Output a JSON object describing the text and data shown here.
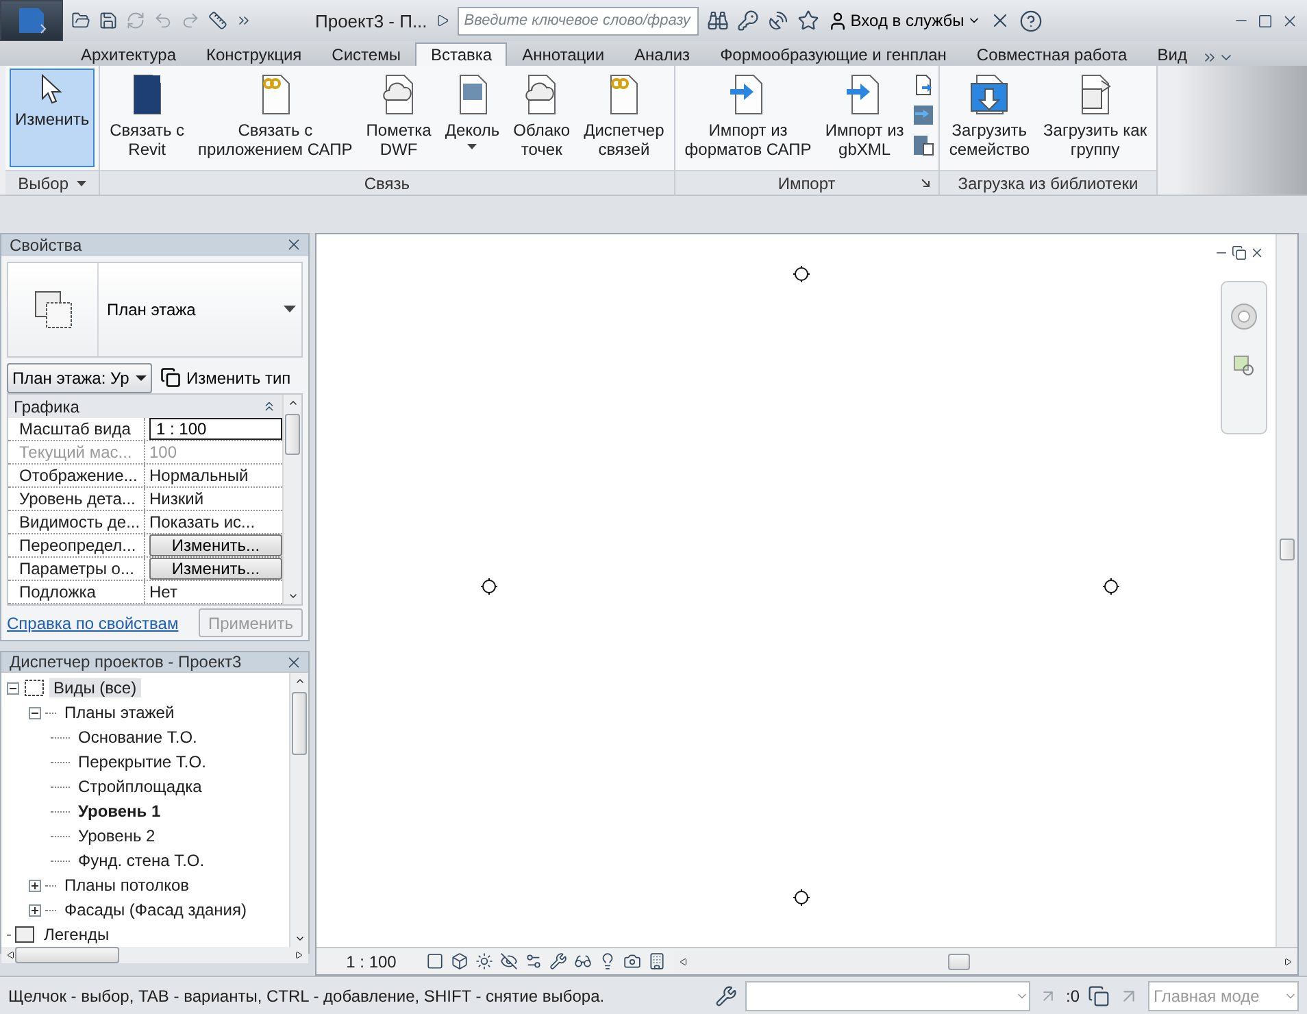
{
  "title_bar": {
    "title": "Проект3 - П...",
    "search": {
      "placeholder": "Введите ключевое слово/фразу"
    },
    "sign_in": "Вход в службы"
  },
  "ribbon_tabs": [
    {
      "label": "Архитектура",
      "selected": false
    },
    {
      "label": "Конструкция",
      "selected": false
    },
    {
      "label": "Системы",
      "selected": false
    },
    {
      "label": "Вставка",
      "selected": true
    },
    {
      "label": "Аннотации",
      "selected": false
    },
    {
      "label": "Анализ",
      "selected": false
    },
    {
      "label": "Формообразующие и генплан",
      "selected": false
    },
    {
      "label": "Совместная работа",
      "selected": false
    },
    {
      "label": "Вид",
      "selected": false
    }
  ],
  "ribbon_panels": [
    {
      "label": "Выбор",
      "menu": true,
      "launcher": false,
      "buttons": [
        {
          "label": "Изменить",
          "active": true,
          "dropdown": false
        }
      ]
    },
    {
      "label": "Связь",
      "menu": false,
      "launcher": false,
      "buttons": [
        {
          "label": "Связать с\nRevit",
          "active": false,
          "dropdown": false
        },
        {
          "label": "Связать с\nприложением САПР",
          "active": false,
          "dropdown": false
        },
        {
          "label": "Пометка\nDWF",
          "active": false,
          "dropdown": false
        },
        {
          "label": "Деколь",
          "active": false,
          "dropdown": true
        },
        {
          "label": "Облако\nточек",
          "active": false,
          "dropdown": false
        },
        {
          "label": "Диспетчер\nсвязей",
          "active": false,
          "dropdown": false
        }
      ]
    },
    {
      "label": "Импорт",
      "menu": false,
      "launcher": true,
      "buttons": [
        {
          "label": "Импорт из\nформатов САПР",
          "active": false,
          "dropdown": false
        },
        {
          "label": "Импорт из\ngbXML",
          "active": false,
          "dropdown": false
        }
      ]
    },
    {
      "label": "Загрузка из библиотеки",
      "menu": false,
      "launcher": false,
      "buttons": [
        {
          "label": "Загрузить\nсемейство",
          "active": false,
          "dropdown": false
        },
        {
          "label": "Загрузить как\nгруппу",
          "active": false,
          "dropdown": false
        }
      ]
    }
  ],
  "properties": {
    "title": "Свойства",
    "type_name": "План этажа",
    "instance_filter": "План этажа: Ур",
    "edit_type": "Изменить тип",
    "group": "Графика",
    "rows": [
      {
        "name": "Масштаб вида",
        "value": "1 : 100",
        "kind": "input",
        "disabled": false
      },
      {
        "name": "Текущий мас...",
        "value": "100",
        "kind": "text",
        "disabled": true
      },
      {
        "name": "Отображение...",
        "value": "Нормальный",
        "kind": "text",
        "disabled": false
      },
      {
        "name": "Уровень дета...",
        "value": "Низкий",
        "kind": "text",
        "disabled": false
      },
      {
        "name": "Видимость де...",
        "value": "Показать ис...",
        "kind": "text",
        "disabled": false
      },
      {
        "name": "Переопредел...",
        "value": "Изменить...",
        "kind": "button",
        "disabled": false
      },
      {
        "name": "Параметры о...",
        "value": "Изменить...",
        "kind": "button",
        "disabled": false
      },
      {
        "name": "Подложка",
        "value": "Нет",
        "kind": "text",
        "disabled": false
      }
    ],
    "help_link": "Справка по свойствам",
    "apply": {
      "label": "Применить",
      "disabled": true
    }
  },
  "project_browser": {
    "title": "Диспетчер проектов - Проект3",
    "tree": [
      {
        "label": "Виды (все)",
        "expanded": true,
        "selected": true,
        "active": false,
        "children": [
          {
            "label": "Планы этажей",
            "expanded": true,
            "selected": false,
            "active": false,
            "children": [
              {
                "label": "Основание Т.О.",
                "selected": false,
                "active": false
              },
              {
                "label": "Перекрытие Т.О.",
                "selected": false,
                "active": false
              },
              {
                "label": "Стройплощадка",
                "selected": false,
                "active": false
              },
              {
                "label": "Уровень 1",
                "selected": false,
                "active": true
              },
              {
                "label": "Уровень 2",
                "selected": false,
                "active": false
              },
              {
                "label": "Фунд. стена Т.О.",
                "selected": false,
                "active": false
              }
            ]
          },
          {
            "label": "Планы потолков",
            "expanded": false,
            "selected": false,
            "active": false
          },
          {
            "label": "Фасады (Фасад здания)",
            "expanded": false,
            "selected": false,
            "active": false
          }
        ]
      },
      {
        "label": "Легенды",
        "selected": false,
        "active": false
      }
    ]
  },
  "view_bar": {
    "scale": "1 : 100"
  },
  "status_bar": {
    "hint": "Щелчок - выбор, TAB - варианты, CTRL - добавление, SHIFT - снятие выбора.",
    "selection_count": ":0",
    "workset": {
      "value": "Главная моде",
      "disabled": true
    }
  }
}
